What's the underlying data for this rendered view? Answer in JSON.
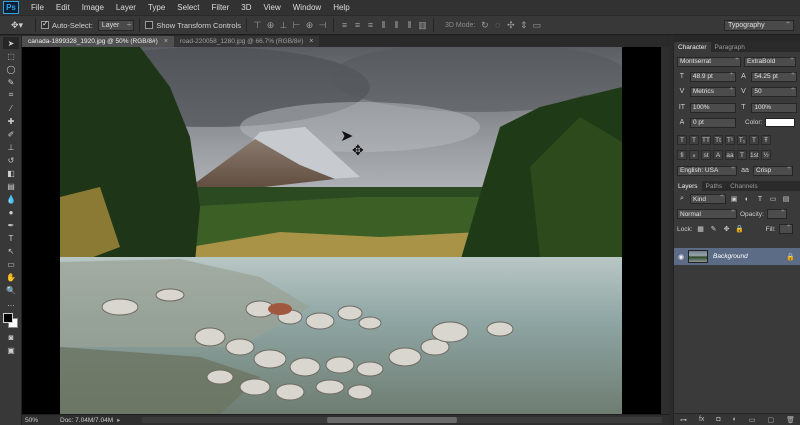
{
  "app": {
    "logo": "Ps"
  },
  "menu": [
    "File",
    "Edit",
    "Image",
    "Layer",
    "Type",
    "Select",
    "Filter",
    "3D",
    "View",
    "Window",
    "Help"
  ],
  "options": {
    "auto_select_label": "Auto-Select:",
    "auto_select_value": "Layer",
    "transform_controls_label": "Show Transform Controls",
    "mode_3d_label": "3D Mode:",
    "workspace": "Typography"
  },
  "tabs": [
    {
      "label": "canada-1899328_1920.jpg @ 50% (RGB/8#)",
      "active": true
    },
    {
      "label": "road-220058_1280.jpg @ 66.7% (RGB/8#)",
      "active": false
    }
  ],
  "status": {
    "zoom": "50%",
    "doc": "Doc: 7.04M/7.04M"
  },
  "character": {
    "tabs": [
      "Character",
      "Paragraph"
    ],
    "font_family": "Montserrat",
    "font_style": "ExtraBold",
    "font_size": "48.9 pt",
    "leading": "54.25 pt",
    "kerning": "Metrics",
    "tracking": "50",
    "vertical_scale": "100%",
    "horizontal_scale": "100%",
    "baseline_shift": "0 pt",
    "color_label": "Color:",
    "language": "English: USA",
    "antialias": "Crisp"
  },
  "layers": {
    "tabs": [
      "Layers",
      "Paths",
      "Channels"
    ],
    "kind": "Kind",
    "blend_mode": "Normal",
    "opacity_label": "Opacity:",
    "lock_label": "Lock:",
    "fill_label": "Fill:",
    "items": [
      {
        "name": "Background"
      }
    ]
  },
  "colors": {
    "accent": "#2fa3e6",
    "selected_layer": "#5d6c86"
  }
}
